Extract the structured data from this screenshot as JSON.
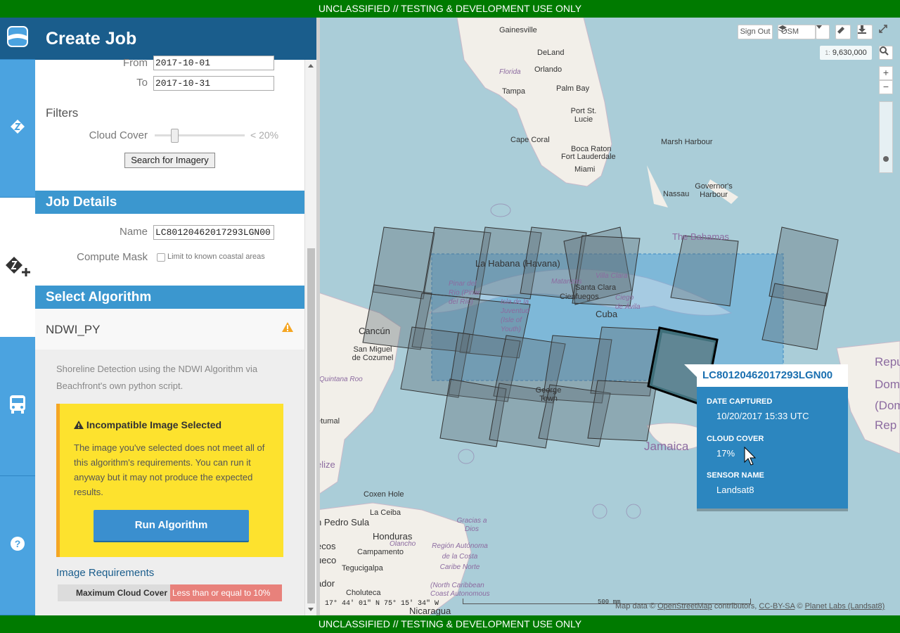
{
  "banner": {
    "text": "UNCLASSIFIED // TESTING & DEVELOPMENT USE ONLY"
  },
  "panel": {
    "title": "Create Job",
    "date_range": {
      "from_label": "From",
      "from_value": "2017-10-01",
      "to_label": "To",
      "to_value": "2017-10-31"
    },
    "filters": {
      "heading": "Filters",
      "cloud_cover_label": "Cloud Cover",
      "cloud_cover_value": "< 20%",
      "cloud_cover_level": 0.2
    },
    "search_button": "Search for Imagery",
    "job_details": {
      "heading": "Job Details",
      "name_label": "Name",
      "name_value": "LC80120462017293LGN00",
      "compute_mask_label": "Compute Mask",
      "compute_mask_option": "Limit to known coastal areas",
      "compute_mask_checked": false
    },
    "select_algorithm": {
      "heading": "Select Algorithm",
      "algorithm_name": "NDWI_PY",
      "description": "Shoreline Detection using the NDWI Algorithm via Beachfront's own python script.",
      "warning_title": "Incompatible Image Selected",
      "warning_text": "The image you've selected does not meet all of this algorithm's requirements. You can run it anyway but it may not produce the expected results.",
      "run_button": "Run Algorithm",
      "requirements_heading": "Image Requirements",
      "requirements": [
        {
          "key": "Maximum Cloud Cover",
          "value": "Less than or equal to 10%"
        }
      ]
    }
  },
  "map": {
    "controls": {
      "sign_out": "Sign Out",
      "basemap": "OSM",
      "scale_prefix": "1:",
      "scale_value": "9,630,000",
      "zoom_in": "+",
      "zoom_out": "−"
    },
    "popup": {
      "title": "LC80120462017293LGN00",
      "date_label": "DATE CAPTURED",
      "date_value": "10/20/2017 15:33 UTC",
      "cloud_label": "CLOUD COVER",
      "cloud_value": "17%",
      "sensor_label": "SENSOR NAME",
      "sensor_value": "Landsat8"
    },
    "places": [
      "Gainesville",
      "DeLand",
      "Florida",
      "Orlando",
      "Tampa",
      "Palm Bay",
      "Port St. Lucie",
      "Cape Coral",
      "Boca Raton",
      "Fort Lauderdale",
      "Miami",
      "Marsh Harbour",
      "Nassau",
      "Governor's Harbour",
      "The Bahamas",
      "La Habana (Havana)",
      "Pinar del Río (Pinar del Río)",
      "Isla de la Juventud (Isle of Youth)",
      "Matanzas",
      "Villa Clara",
      "Santa Clara",
      "Cienfuegos",
      "Cuba",
      "Ciego de Ávila",
      "Cancún",
      "San Miguel de Cozumel",
      "Quintana Roo",
      "George Town",
      "Jamaica",
      "Repu",
      "Domi",
      "(Dom",
      "Rep",
      "etumal",
      "elize",
      "Coxen Hole",
      "La Ceiba",
      "n Pedro Sula",
      "Honduras",
      "Olancho",
      "Gracias a Dios",
      "Región Autónoma de la Costa Caribe Norte",
      "(North Caribbean Coast Autonomous",
      "Campamento",
      "Tegucigalpa",
      "Choluteca",
      "Nicaragua",
      "ador",
      "ueco",
      "ecos"
    ],
    "coords": "17° 44′ 01″ N 75° 15′ 34″ W",
    "scalebar": "500 mm",
    "attribution": {
      "prefix": "Map data ©",
      "osm": "OpenStreetMap",
      "mid": "contributors,",
      "license": "CC-BY-SA",
      "copy": "©",
      "planet": "Planet Labs (Landsat8)"
    }
  }
}
